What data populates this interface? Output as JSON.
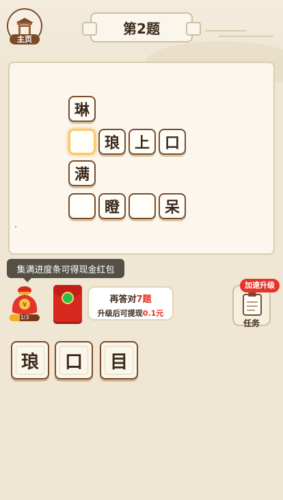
{
  "header": {
    "home_label": "主页",
    "title": "第2题"
  },
  "board": {
    "cells": [
      {
        "text": "琳",
        "selected": false
      },
      {
        "text": "",
        "selected": true
      },
      {
        "text": "琅",
        "selected": false
      },
      {
        "text": "上",
        "selected": false
      },
      {
        "text": "口",
        "selected": false
      },
      {
        "text": "满",
        "selected": false
      },
      {
        "text": "",
        "selected": false
      },
      {
        "text": "瞪",
        "selected": false
      },
      {
        "text": "",
        "selected": false
      },
      {
        "text": "呆",
        "selected": false
      }
    ]
  },
  "reward": {
    "tooltip": "集满进度条可得现金红包",
    "progress_text": "1/3",
    "progress_fraction": 0.333,
    "quest_line1_prefix": "再答对",
    "quest_line1_highlight": "7题",
    "quest_line2_prefix": "升级后可提现",
    "quest_line2_highlight": "0.1元"
  },
  "task": {
    "badge": "加速升级",
    "label": "任务"
  },
  "options": [
    "琅",
    "口",
    "目"
  ],
  "colors": {
    "background": "#efe6d3",
    "accent_brown": "#7a4a2a",
    "highlight_red": "#e0301e"
  }
}
